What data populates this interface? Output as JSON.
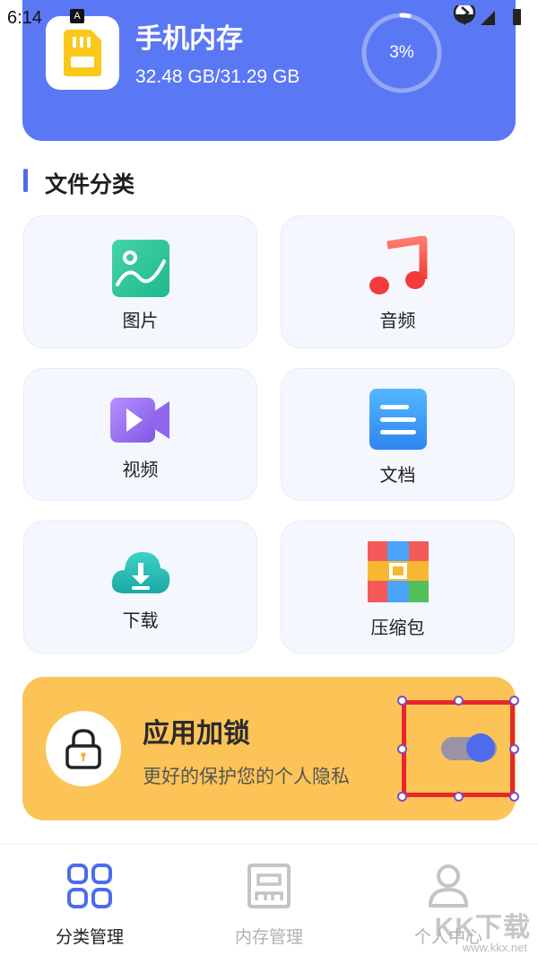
{
  "status_bar": {
    "time": "6:14",
    "badge": "A",
    "icons": [
      "nav-arrow-icon",
      "wifi-icon",
      "signal-icon",
      "battery-icon"
    ]
  },
  "storage": {
    "title": "手机内存",
    "usage": "32.48 GB/31.29 GB",
    "percent_label": "3%",
    "percent_value": 3,
    "icon": "sd-card-icon",
    "card_color": "#5b78f4"
  },
  "section": {
    "title": "文件分类",
    "accent": "#4f6bed"
  },
  "categories": [
    {
      "label": "图片",
      "icon": "image-icon"
    },
    {
      "label": "音频",
      "icon": "music-icon"
    },
    {
      "label": "视频",
      "icon": "video-icon"
    },
    {
      "label": "文档",
      "icon": "document-icon"
    },
    {
      "label": "下载",
      "icon": "cloud-download-icon"
    },
    {
      "label": "压缩包",
      "icon": "archive-icon"
    }
  ],
  "app_lock": {
    "title": "应用加锁",
    "subtitle": "更好的保护您的个人隐私",
    "icon": "lock-icon",
    "enabled": true,
    "color": "#fcc457"
  },
  "bottom_nav": {
    "items": [
      {
        "label": "分类管理",
        "icon": "grid-icon",
        "active": true
      },
      {
        "label": "内存管理",
        "icon": "memory-icon",
        "active": false
      },
      {
        "label": "个人中心",
        "icon": "person-icon",
        "active": false
      }
    ],
    "active_color": "#4f6bed",
    "inactive_color": "#b8b8b8"
  },
  "watermark": {
    "text": "KK下载",
    "url": "www.kkx.net"
  }
}
